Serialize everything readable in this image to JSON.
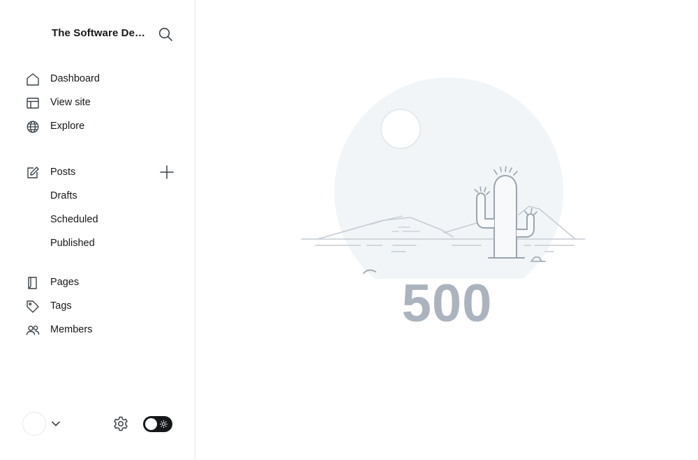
{
  "sidebar": {
    "site_title": "The Software Developer's Guide",
    "nav_main": [
      {
        "label": "Dashboard",
        "icon": "home-icon"
      },
      {
        "label": "View site",
        "icon": "layout-icon"
      },
      {
        "label": "Explore",
        "icon": "globe-icon"
      }
    ],
    "posts": {
      "label": "Posts",
      "icon": "edit-icon",
      "sub": [
        {
          "label": "Drafts"
        },
        {
          "label": "Scheduled"
        },
        {
          "label": "Published"
        }
      ]
    },
    "nav_secondary": [
      {
        "label": "Pages",
        "icon": "page-icon"
      },
      {
        "label": "Tags",
        "icon": "tag-icon"
      },
      {
        "label": "Members",
        "icon": "members-icon"
      }
    ]
  },
  "footer": {
    "settings_icon": "gear-icon",
    "theme_toggle_icon": "sun-icon"
  },
  "error": {
    "code": "500"
  },
  "colors": {
    "accent_dark": "#15171a",
    "muted_error": "#abb4be",
    "illustration_line": "#9aa4ad",
    "illustration_bg": "#f1f5f8"
  }
}
